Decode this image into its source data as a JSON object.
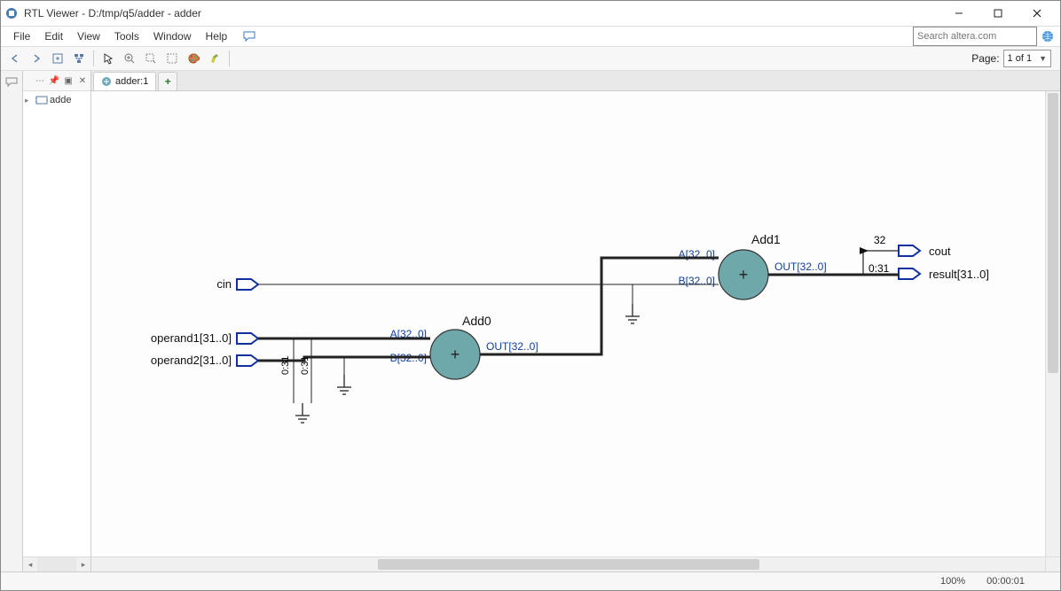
{
  "window": {
    "title": "RTL Viewer - D:/tmp/q5/adder - adder"
  },
  "menu": {
    "file": "File",
    "edit": "Edit",
    "view": "View",
    "tools": "Tools",
    "window": "Window",
    "help": "Help"
  },
  "search": {
    "placeholder": "Search altera.com"
  },
  "page": {
    "label": "Page:",
    "value": "1 of 1"
  },
  "tree": {
    "root_label": "adde"
  },
  "tab": {
    "label": "adder:1"
  },
  "diagram": {
    "inputs": {
      "cin": "cin",
      "op1": "operand1[31..0]",
      "op2": "operand2[31..0]"
    },
    "outputs": {
      "cout": "cout",
      "result": "result[31..0]"
    },
    "add0": {
      "name": "Add0",
      "portA": "A[32..0]",
      "portB": "B[32..0]",
      "portOUT": "OUT[32..0]"
    },
    "add1": {
      "name": "Add1",
      "portA": "A[32..0]",
      "portB": "B[32..0]",
      "portOUT": "OUT[32..0]"
    },
    "bus_label_031": "0:31",
    "bus_label_031_2": "0:31",
    "bus_label_32": "32",
    "bus_label_031_3": "0:31"
  },
  "status": {
    "zoom": "100%",
    "time": "00:00:01"
  }
}
